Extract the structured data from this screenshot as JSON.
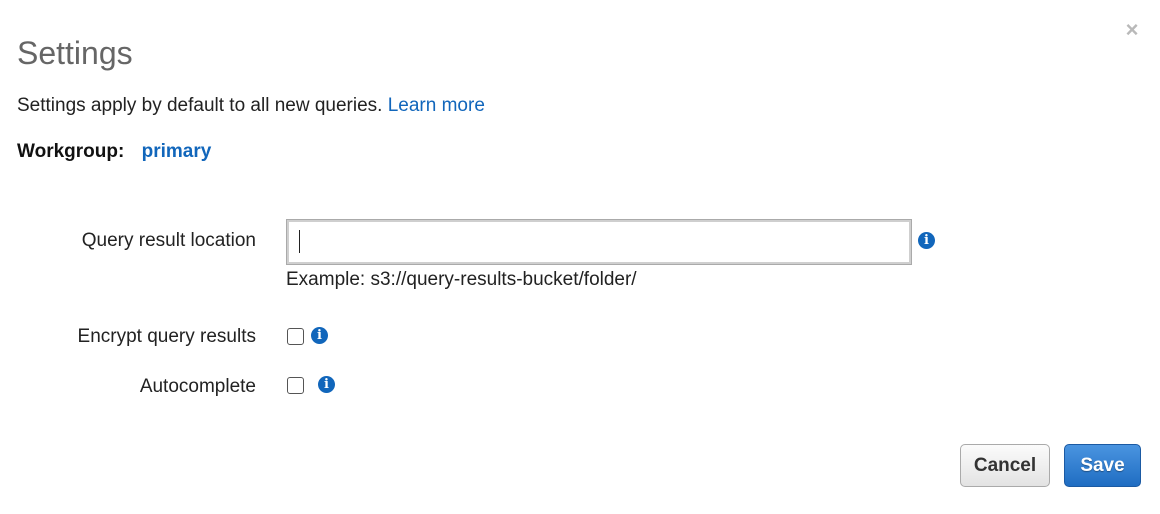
{
  "dialog": {
    "title": "Settings",
    "close_label": "×",
    "intro_text": "Settings apply by default to all new queries.",
    "learn_more_label": "Learn more",
    "workgroup_label": "Workgroup:",
    "workgroup_value": "primary"
  },
  "form": {
    "query_result_location": {
      "label": "Query result location",
      "value": "",
      "placeholder": "",
      "hint": "Example: s3://query-results-bucket/folder/"
    },
    "encrypt_query_results": {
      "label": "Encrypt query results",
      "checked": false
    },
    "autocomplete": {
      "label": "Autocomplete",
      "checked": false
    },
    "info_icon_glyph": "i"
  },
  "actions": {
    "cancel_label": "Cancel",
    "save_label": "Save"
  },
  "colors": {
    "link": "#1166bb",
    "info_icon": "#1166bb",
    "save_button": "#1f6dc2"
  }
}
